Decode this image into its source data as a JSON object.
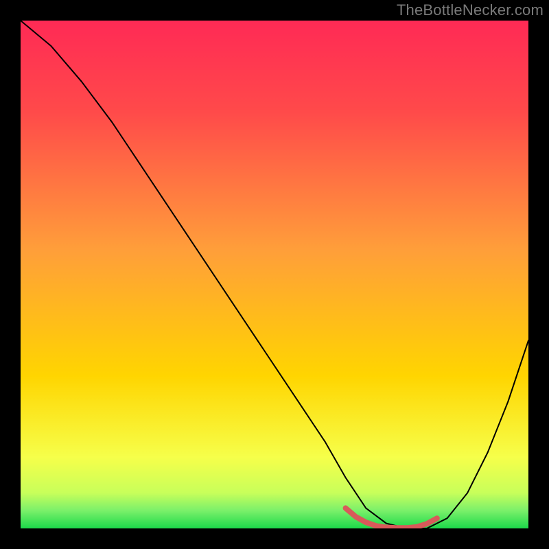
{
  "watermark": "TheBottleNecker.com",
  "chart_data": {
    "type": "line",
    "title": "",
    "xlabel": "",
    "ylabel": "",
    "xlim": [
      0,
      100
    ],
    "ylim": [
      0,
      100
    ],
    "axes_visible": false,
    "grid": false,
    "background_gradient": {
      "top": "#ff2a55",
      "mid": "#ffd500",
      "bottom": "#1cd94a"
    },
    "series": [
      {
        "name": "bottleneck-curve",
        "color": "#000000",
        "stroke_width": 2,
        "x": [
          0,
          6,
          12,
          18,
          24,
          30,
          36,
          42,
          48,
          54,
          60,
          64,
          68,
          72,
          76,
          80,
          84,
          88,
          92,
          96,
          100
        ],
        "y": [
          100,
          95,
          88,
          80,
          71,
          62,
          53,
          44,
          35,
          26,
          17,
          10,
          4,
          1,
          0,
          0,
          2,
          7,
          15,
          25,
          37
        ]
      }
    ],
    "highlight_segment": {
      "name": "optimal-range",
      "color": "#d85a5a",
      "stroke_width": 8,
      "x": [
        64,
        66,
        68,
        70,
        72,
        74,
        76,
        78,
        80,
        82
      ],
      "y": [
        4,
        2.3,
        1.2,
        0.5,
        0.2,
        0.1,
        0.1,
        0.3,
        0.9,
        2.0
      ]
    }
  }
}
